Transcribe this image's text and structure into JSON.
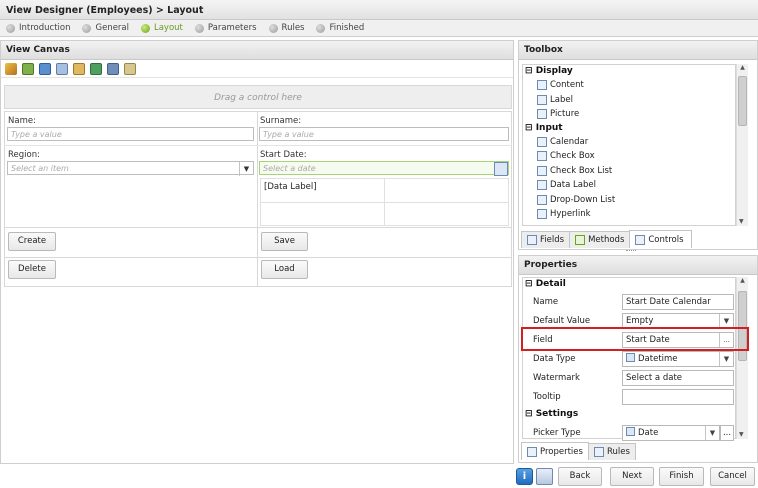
{
  "title": "View Designer (Employees) > Layout",
  "steps": [
    {
      "label": "Introduction",
      "active": false
    },
    {
      "label": "General",
      "active": false
    },
    {
      "label": "Layout",
      "active": true
    },
    {
      "label": "Parameters",
      "active": false
    },
    {
      "label": "Rules",
      "active": false
    },
    {
      "label": "Finished",
      "active": false
    }
  ],
  "canvas": {
    "title": "View Canvas",
    "drag_hint": "Drag a control here",
    "name_label": "Name:",
    "name_placeholder": "Type a value",
    "surname_label": "Surname:",
    "surname_placeholder": "Type a value",
    "region_label": "Region:",
    "region_placeholder": "Select an item",
    "start_date_label": "Start Date:",
    "start_date_placeholder": "Select a date",
    "data_label": "[Data Label]",
    "create": "Create",
    "save": "Save",
    "delete": "Delete",
    "load": "Load"
  },
  "toolbox": {
    "title": "Toolbox",
    "categories": [
      {
        "name": "Display",
        "items": [
          "Content",
          "Label",
          "Picture"
        ]
      },
      {
        "name": "Input",
        "items": [
          "Calendar",
          "Check Box",
          "Check Box List",
          "Data Label",
          "Drop-Down List",
          "Hyperlink"
        ]
      }
    ],
    "tabs": [
      "Fields",
      "Methods",
      "Controls"
    ]
  },
  "properties": {
    "title": "Properties",
    "detail_label": "Detail",
    "settings_label": "Settings",
    "rows": [
      {
        "label": "Name",
        "value": "Start Date Calendar"
      },
      {
        "label": "Default Value",
        "value": "Empty"
      },
      {
        "label": "Field",
        "value": "Start Date"
      },
      {
        "label": "Data Type",
        "value": "Datetime"
      },
      {
        "label": "Watermark",
        "value": "Select a date"
      },
      {
        "label": "Tooltip",
        "value": ""
      }
    ],
    "picker_label": "Picker Type",
    "picker_value": "Date",
    "tabs": [
      "Properties",
      "Rules"
    ]
  },
  "footer": {
    "back": "Back",
    "next": "Next",
    "finish": "Finish",
    "cancel": "Cancel"
  },
  "colors": {
    "accent_green": "#6aa31c",
    "highlight_red": "#d22020"
  }
}
